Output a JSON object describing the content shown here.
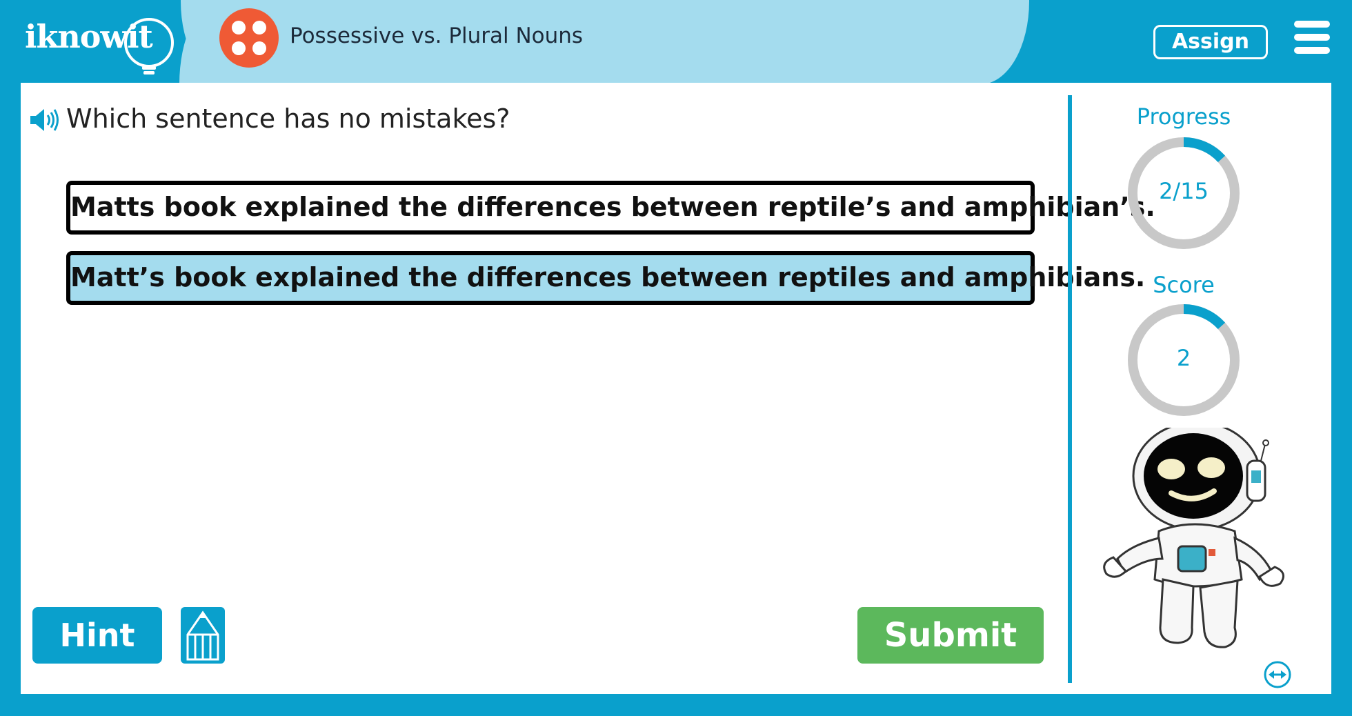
{
  "header": {
    "logo_text": "iknowit",
    "topic_title": "Possessive vs. Plural Nouns",
    "assign_label": "Assign"
  },
  "question": {
    "prompt": "Which sentence has no mistakes?",
    "choices": [
      {
        "text": "Matts book explained the differences between reptile’s and amphibian’s.",
        "selected": false
      },
      {
        "text": "Matt’s book explained the differences between reptiles and amphibians.",
        "selected": true
      }
    ]
  },
  "actions": {
    "hint_label": "Hint",
    "submit_label": "Submit"
  },
  "stats": {
    "progress_label": "Progress",
    "progress_text": "2/15",
    "progress_fraction": 0.133,
    "score_label": "Score",
    "score_text": "2",
    "score_fraction": 0.133
  },
  "colors": {
    "brand_blue": "#0aa0cc",
    "pill_blue": "#a4dcee",
    "topic_icon": "#ef5a35",
    "submit_green": "#5cb85c",
    "ring_track": "#c8c8c8"
  },
  "icons": {
    "speaker": "speaker-icon",
    "menu": "hamburger-menu-icon",
    "pencil": "pencil-icon",
    "expand": "expand-arrows-icon"
  }
}
